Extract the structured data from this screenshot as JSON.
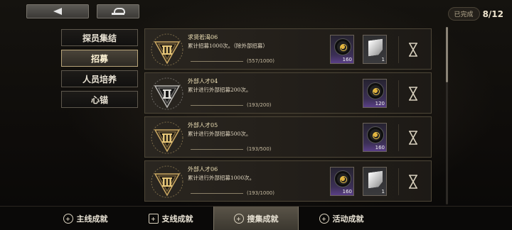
{
  "header": {
    "progress_label": "已完成",
    "progress_count": "8/12"
  },
  "side_menu": {
    "items": [
      {
        "label": "探员集结",
        "active": false
      },
      {
        "label": "招募",
        "active": true
      },
      {
        "label": "人员培养",
        "active": false
      },
      {
        "label": "心锚",
        "active": false
      }
    ]
  },
  "achievements": [
    {
      "tier": "III",
      "title": "求贤若渴06",
      "description": "累计招募1000次。（除外部招募）",
      "progress_text": "(557/1000)",
      "rewards": [
        {
          "icon": "record-disc-icon",
          "rarity": "purple",
          "quantity": "160"
        },
        {
          "icon": "paper-sheet-icon",
          "rarity": "gray",
          "quantity": "1"
        }
      ]
    },
    {
      "tier": "II",
      "title": "外部人才04",
      "description": "累计进行外部招募200次。",
      "progress_text": "(193/200)",
      "rewards": [
        {
          "icon": "record-disc-icon",
          "rarity": "purple",
          "quantity": "120"
        }
      ]
    },
    {
      "tier": "III",
      "title": "外部人才05",
      "description": "累计进行外部招募500次。",
      "progress_text": "(193/500)",
      "rewards": [
        {
          "icon": "record-disc-icon",
          "rarity": "purple",
          "quantity": "160"
        }
      ]
    },
    {
      "tier": "III",
      "title": "外部人才06",
      "description": "累计进行外部招募1000次。",
      "progress_text": "(193/1000)",
      "rewards": [
        {
          "icon": "record-disc-icon",
          "rarity": "purple",
          "quantity": "160"
        },
        {
          "icon": "paper-sheet-icon",
          "rarity": "gray",
          "quantity": "1"
        }
      ]
    }
  ],
  "tabs": [
    {
      "label": "主线成就",
      "icon": "shield-plus-icon",
      "active": false
    },
    {
      "label": "支线成就",
      "icon": "card-plus-icon",
      "active": false
    },
    {
      "label": "搜集成就",
      "icon": "shield-plus-icon",
      "active": true
    },
    {
      "label": "活动成就",
      "icon": "shield-plus-icon",
      "active": false
    }
  ],
  "colors": {
    "accent_gold": "#c9a762",
    "rarity_purple": "#5a3f86"
  }
}
